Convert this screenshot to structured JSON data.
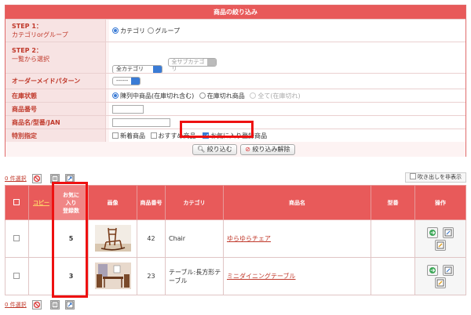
{
  "filter": {
    "title": "商品の絞り込み",
    "step1": {
      "label": "STEP 1：",
      "sub": "カテゴリorグループ",
      "options": [
        "カテゴリ",
        "グループ"
      ]
    },
    "step2": {
      "label": "STEP 2：",
      "sub": "一覧から選択",
      "category": "全カテゴリ",
      "subcategory": "全サブカテゴリ"
    },
    "order_made": {
      "label": "オーダーメイドパターン",
      "value": "------"
    },
    "stock": {
      "label": "在庫状態",
      "options": [
        "陳列中商品(在庫切れ含む)",
        "在庫切れ商品",
        "全て(在庫切れ)"
      ]
    },
    "item_no": {
      "label": "商品番号"
    },
    "item_name": {
      "label": "商品名/型番/JAN"
    },
    "special": {
      "label": "特別指定",
      "options": [
        "新着商品",
        "おすすめ商品",
        "お気に入り登録商品"
      ]
    },
    "search_button": "絞り込む",
    "clear_button": "絞り込み解除"
  },
  "toolbar": {
    "selected_count": "0 件選択",
    "hide_balloon": "吹き出しを非表示"
  },
  "table": {
    "headers": {
      "copy": "コピー",
      "favorites": [
        "お気に",
        "入り",
        "登録数"
      ],
      "image": "画像",
      "item_no": "商品番号",
      "category": "カテゴリ",
      "name": "商品名",
      "model": "型番",
      "ops": "操作"
    },
    "rows": [
      {
        "favorites": "5",
        "item_no": "42",
        "category": "Chair",
        "name": "ゆらゆらチェア"
      },
      {
        "favorites": "3",
        "item_no": "23",
        "category": [
          "テーブル:長方形テ",
          "ーブル"
        ],
        "name": "ミニダイニングテーブル"
      }
    ]
  },
  "colors": {
    "accent": "#e85a5a",
    "highlight": "#ee1111",
    "radio": "#3a7bd5"
  },
  "icons": [
    "delete-icon",
    "export-icon",
    "import-icon",
    "copy-icon",
    "edit-icon",
    "checkbox-icon"
  ]
}
